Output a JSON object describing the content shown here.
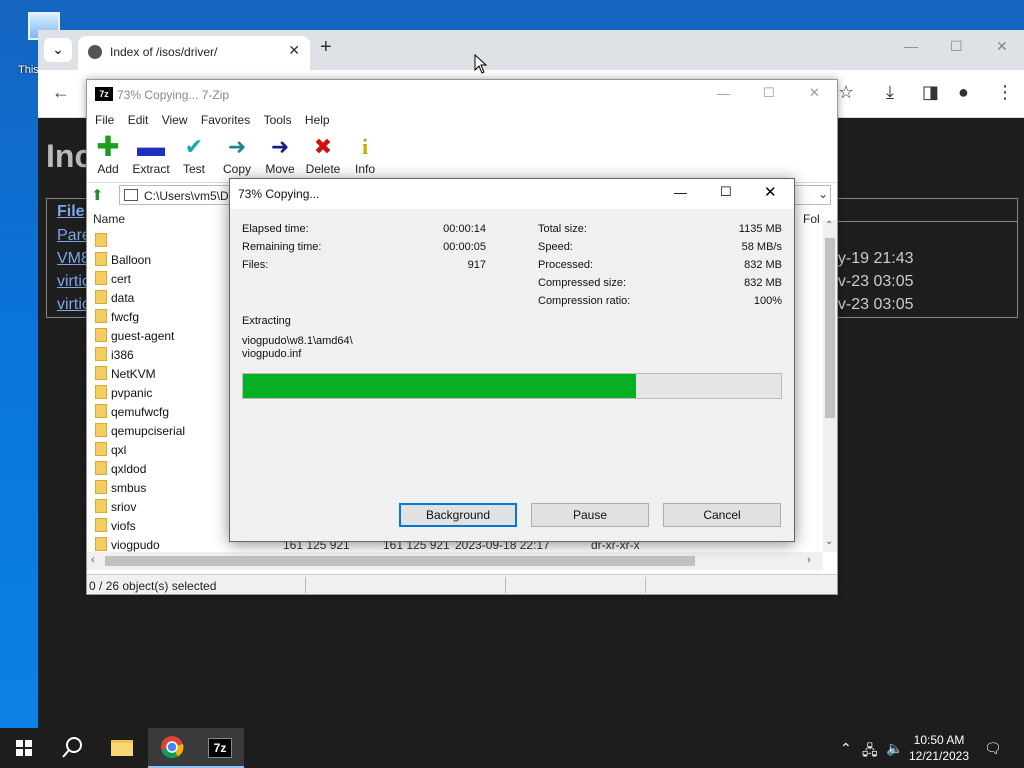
{
  "desktop": {
    "icon_label": "This"
  },
  "browser": {
    "tab_title": "Index of /isos/driver/",
    "tab_close": "✕",
    "new_tab": "+",
    "page_heading": "Inc",
    "table_header": "File",
    "links": [
      "Pare",
      "VM8",
      "virtic",
      "virtic"
    ],
    "dates": [
      "ay-19 21:43",
      "ov-23 03:05",
      "ov-23 03:05"
    ]
  },
  "zip_window": {
    "title": "73% Copying... 7-Zip",
    "app_icon": "7z",
    "menu": [
      "File",
      "Edit",
      "View",
      "Favorites",
      "Tools",
      "Help"
    ],
    "tools": [
      {
        "label": "Add",
        "icon": "plus-icon",
        "color": "#1e9e1e"
      },
      {
        "label": "Extract",
        "icon": "minus-icon",
        "color": "#1f2fbf"
      },
      {
        "label": "Test",
        "icon": "check-icon",
        "color": "#1aa6b5"
      },
      {
        "label": "Copy",
        "icon": "arrow-right-icon",
        "color": "#1a8a86"
      },
      {
        "label": "Move",
        "icon": "arrow-right-icon",
        "color": "#1a1a8a"
      },
      {
        "label": "Delete",
        "icon": "x-icon",
        "color": "#d01010"
      },
      {
        "label": "Info",
        "icon": "info-icon",
        "color": "#c9a800"
      }
    ],
    "address": "C:\\Users\\vm5\\D",
    "column_name": "Name",
    "column_folders": "Fol",
    "folders": [
      "",
      "Balloon",
      "cert",
      "data",
      "fwcfg",
      "guest-agent",
      "i386",
      "NetKVM",
      "pvpanic",
      "qemufwcfg",
      "qemupciserial",
      "qxl",
      "qxldod",
      "smbus",
      "sriov",
      "viofs",
      "viogpudo"
    ],
    "last_row": {
      "size": "161 125 921",
      "packed": "161 125 921",
      "modified": "2023-09-18 22:17",
      "attributes": "dr-xr-xr-x"
    },
    "status": "0 / 26 object(s) selected"
  },
  "progress_dialog": {
    "title": "73% Copying...",
    "left_stats": [
      {
        "label": "Elapsed time:",
        "value": "00:00:14"
      },
      {
        "label": "Remaining time:",
        "value": "00:00:05"
      },
      {
        "label": "Files:",
        "value": "917"
      }
    ],
    "right_stats": [
      {
        "label": "Total size:",
        "value": "1135 MB"
      },
      {
        "label": "Speed:",
        "value": "58 MB/s"
      },
      {
        "label": "Processed:",
        "value": "832 MB"
      },
      {
        "label": "Compressed size:",
        "value": "832 MB"
      },
      {
        "label": "Compression ratio:",
        "value": "100%"
      }
    ],
    "operation": "Extracting",
    "current_path": "viogpudo\\w8.1\\amd64\\",
    "current_file": "viogpudo.inf",
    "progress_fraction": 0.73,
    "progress_color": "#06b025",
    "buttons": {
      "background": "Background",
      "pause": "Pause",
      "cancel": "Cancel"
    }
  },
  "taskbar": {
    "time": "10:50 AM",
    "date": "12/21/2023",
    "zip_label": "7z"
  }
}
